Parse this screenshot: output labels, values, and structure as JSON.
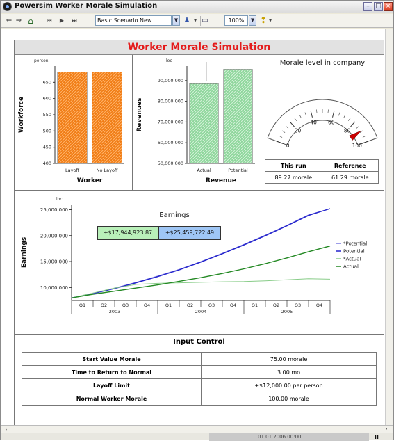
{
  "window": {
    "title": "Powersim Worker Morale Simulation",
    "controls": {
      "minimize": "–",
      "maximize": "□",
      "close": "×"
    }
  },
  "toolbar": {
    "back": "⇐",
    "forward": "⇒",
    "home": "⌂",
    "rewind": "⏮",
    "play": "▶",
    "step": "⏭",
    "scenario": "Basic Scenario New",
    "zoom": "100%"
  },
  "dashboard": {
    "title": "Worker Morale Simulation",
    "colors": {
      "title": "#e41b1b",
      "orange": "#f07d16",
      "green": "#8fd69c",
      "gauge_needle": "#cc0000"
    }
  },
  "workforce_chart": {
    "chart_data": {
      "type": "bar",
      "unit": "person",
      "ylabel": "Workforce",
      "xlabel": "Worker",
      "categories": [
        "Layoff",
        "No Layoff"
      ],
      "values": [
        682,
        682
      ],
      "ylim": [
        400,
        700
      ],
      "yticks": [
        "650",
        "600",
        "550",
        "500",
        "450",
        "400"
      ]
    }
  },
  "revenue_chart": {
    "chart_data": {
      "type": "bar",
      "unit": "loc",
      "ylabel": "Revenues",
      "xlabel": "Revenue",
      "categories": [
        "Actual",
        "Potential"
      ],
      "values": [
        88500000,
        95500000
      ],
      "ylim": [
        50000000,
        97000000
      ],
      "yticks": [
        "90,000,000",
        "80,000,000",
        "70,000,000",
        "60,000,000",
        "50,000,000"
      ]
    }
  },
  "morale_gauge": {
    "title": "Morale level in company",
    "value": 89.27,
    "range": [
      0,
      100
    ],
    "ticks": [
      "0",
      "20",
      "40",
      "60",
      "80",
      "100"
    ],
    "table": {
      "headers": [
        "This run",
        "Reference"
      ],
      "values": [
        "89.27 morale",
        "61.29 morale"
      ]
    }
  },
  "earnings_chart": {
    "chart_data": {
      "type": "line",
      "title": "Earnings",
      "unit": "loc",
      "ylabel": "Earnings",
      "yticks": [
        "25,000,000",
        "20,000,000",
        "15,000,000",
        "10,000,000"
      ],
      "ylim": [
        7500000,
        26000000
      ],
      "quarters": [
        "Q1",
        "Q2",
        "Q3",
        "Q4",
        "Q1",
        "Q2",
        "Q3",
        "Q4",
        "Q1",
        "Q2",
        "Q3",
        "Q4"
      ],
      "years": [
        "2003",
        "2004",
        "2005"
      ],
      "x": [
        0,
        1,
        2,
        3,
        4,
        5,
        6,
        7,
        8,
        9,
        10,
        11,
        12
      ],
      "series": [
        {
          "name": "*Potential",
          "color": "#7a7ae0",
          "values": [
            8000000,
            8900000,
            9900000,
            11000000,
            12200000,
            13500000,
            15000000,
            16600000,
            18300000,
            20100000,
            22000000,
            24000000,
            25200000
          ]
        },
        {
          "name": "Potential",
          "color": "#2222cc",
          "values": [
            8000000,
            8850000,
            9800000,
            10900000,
            12100000,
            13400000,
            14900000,
            16500000,
            18200000,
            20000000,
            21900000,
            23900000,
            25200000
          ]
        },
        {
          "name": "*Actual",
          "color": "#88cc88",
          "values": [
            8000000,
            8950000,
            9900000,
            10600000,
            10800000,
            10900000,
            11000000,
            11100000,
            11150000,
            11300000,
            11500000,
            11700000,
            11600000
          ]
        },
        {
          "name": "Actual",
          "color": "#228822",
          "values": [
            8000000,
            8700000,
            9300000,
            9900000,
            10500000,
            11200000,
            11900000,
            12700000,
            13600000,
            14600000,
            15700000,
            16900000,
            18000000
          ]
        }
      ],
      "value_boxes": [
        "+$17,944,923.87",
        "+$25,459,722.49"
      ]
    }
  },
  "input_control": {
    "title": "Input Control",
    "rows": [
      {
        "label": "Start Value Morale",
        "value": "75.00 morale"
      },
      {
        "label": "Time to Return to Normal",
        "value": "3.00 mo"
      },
      {
        "label": "Layoff Limit",
        "value": "+$12,000.00 per person"
      },
      {
        "label": "Normal Worker Morale",
        "value": "100.00 morale"
      }
    ]
  },
  "status": {
    "time": "01.01.2006 00:00",
    "pause": "II"
  }
}
